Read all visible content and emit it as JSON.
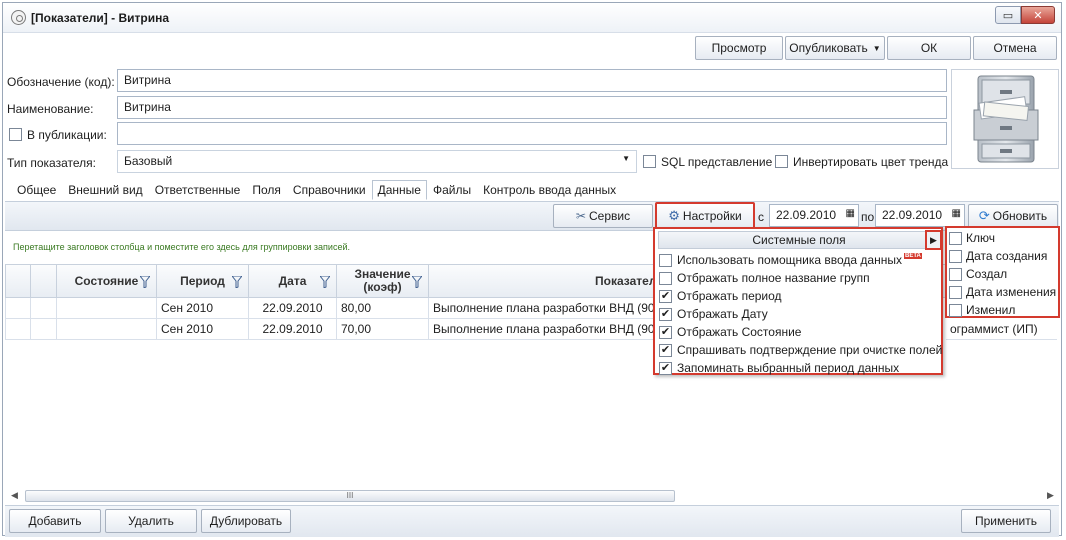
{
  "window": {
    "title": "[Показатели] - Витрина"
  },
  "toolbar": {
    "preview": "Просмотр",
    "publish": "Опубликовать",
    "ok": "ОК",
    "cancel": "Отмена"
  },
  "form": {
    "code_label": "Обозначение (код):",
    "code_value": "Витрина",
    "name_label": "Наименование:",
    "name_value": "Витрина",
    "in_publications_label": "В публикации:",
    "in_publications_value": "",
    "type_label": "Тип показателя:",
    "type_value": "Базовый",
    "sql_view_label": "SQL представление",
    "invert_color_label": "Инвертировать цвет тренда"
  },
  "tabs": [
    "Общее",
    "Внешний вид",
    "Ответственные",
    "Поля",
    "Справочники",
    "Данные",
    "Файлы",
    "Контроль ввода данных"
  ],
  "data_toolbar": {
    "service": "Сервис",
    "settings": "Настройки",
    "from_label": "с",
    "from_date": "22.09.2010",
    "to_label": "по",
    "to_date": "22.09.2010",
    "refresh": "Обновить"
  },
  "group_hint": "Перетащите заголовок столбца и поместите его здесь для группировки записей.",
  "grid": {
    "columns": [
      "Состояние",
      "Период",
      "Дата",
      "Значение (коэф)",
      "Показатель"
    ],
    "value_col_line1": "Значение",
    "value_col_line2": "(коэф)",
    "rows": [
      {
        "state": "",
        "period": "Сен 2010",
        "date": "22.09.2010",
        "value": "80,00",
        "indicator": "Выполнение плана разработки ВНД (90)"
      },
      {
        "state": "",
        "period": "Сен 2010",
        "date": "22.09.2010",
        "value": "70,00",
        "indicator": "Выполнение плана разработки ВНД (90)"
      }
    ],
    "row2_trailing": "ограммист (ИП)"
  },
  "settings_popup": {
    "header": "Системные поля",
    "items": [
      {
        "label": "Использовать помощника ввода данных",
        "checked": false,
        "badge": "BETA"
      },
      {
        "label": "Отбражать полное название групп",
        "checked": false
      },
      {
        "label": "Отбражать период",
        "checked": true
      },
      {
        "label": "Отбражать Дату",
        "checked": true
      },
      {
        "label": "Отбражать Состояние",
        "checked": true
      },
      {
        "label": "Спрашивать подтверждение при очистке полей",
        "checked": true
      },
      {
        "label": "Запоминать выбранный период данных",
        "checked": true
      }
    ]
  },
  "system_fields": [
    {
      "label": "Ключ",
      "checked": false
    },
    {
      "label": "Дата создания",
      "checked": false
    },
    {
      "label": "Создал",
      "checked": false
    },
    {
      "label": "Дата изменения",
      "checked": false
    },
    {
      "label": "Изменил",
      "checked": false
    }
  ],
  "scrollbar": {
    "thumb_glyph": "III"
  },
  "bottom": {
    "add": "Добавить",
    "delete": "Удалить",
    "duplicate": "Дублировать",
    "apply": "Применить"
  },
  "colors": {
    "highlight": "#d43a2e",
    "hint_green": "#3a7a22"
  }
}
